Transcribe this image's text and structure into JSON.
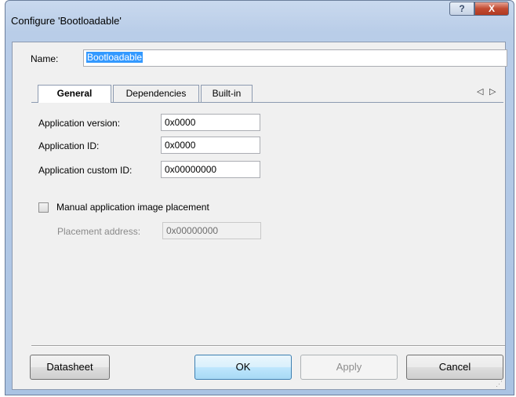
{
  "window": {
    "title": "Configure 'Bootloadable'",
    "help_glyph": "?",
    "close_glyph": "X"
  },
  "name": {
    "label": "Name:",
    "value": "Bootloadable"
  },
  "tabs": [
    {
      "label": "General",
      "active": true
    },
    {
      "label": "Dependencies",
      "active": false
    },
    {
      "label": "Built-in",
      "active": false
    }
  ],
  "tab_nav": {
    "prev": "◁",
    "next": "▷"
  },
  "general": {
    "app_version_label": "Application version:",
    "app_version_value": "0x0000",
    "app_id_label": "Application ID:",
    "app_id_value": "0x0000",
    "app_custom_id_label": "Application custom ID:",
    "app_custom_id_value": "0x00000000",
    "manual_placement_label": "Manual application image placement",
    "manual_placement_checked": false,
    "placement_address_label": "Placement address:",
    "placement_address_value": "0x00000000"
  },
  "buttons": {
    "datasheet": "Datasheet",
    "ok": "OK",
    "apply": "Apply",
    "cancel": "Cancel"
  }
}
